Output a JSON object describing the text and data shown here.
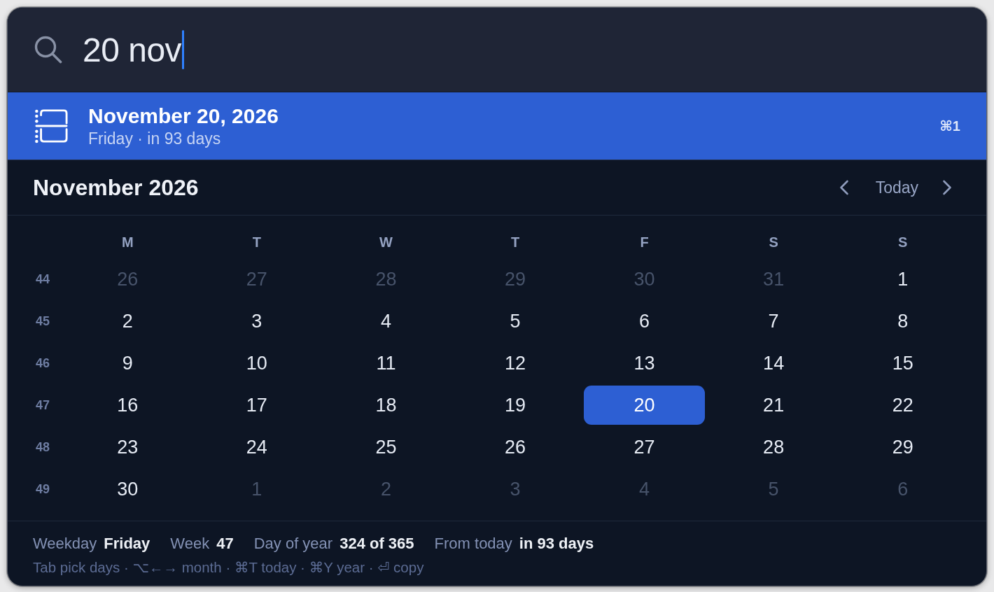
{
  "search": {
    "value": "20 nov"
  },
  "results": [
    {
      "title": "November 20, 2026",
      "subtitle": "Friday · in 93 days",
      "shortcut": "⌘1",
      "selected": true
    }
  ],
  "calendar": {
    "title": "November 2026",
    "today_button": "Today",
    "weekdays": [
      "M",
      "T",
      "W",
      "T",
      "F",
      "S",
      "S"
    ],
    "weeks": [
      {
        "number": "44",
        "days": [
          {
            "label": "26",
            "in_month": false,
            "selected": false
          },
          {
            "label": "27",
            "in_month": false,
            "selected": false
          },
          {
            "label": "28",
            "in_month": false,
            "selected": false
          },
          {
            "label": "29",
            "in_month": false,
            "selected": false
          },
          {
            "label": "30",
            "in_month": false,
            "selected": false
          },
          {
            "label": "31",
            "in_month": false,
            "selected": false
          },
          {
            "label": "1",
            "in_month": true,
            "selected": false
          }
        ]
      },
      {
        "number": "45",
        "days": [
          {
            "label": "2",
            "in_month": true,
            "selected": false
          },
          {
            "label": "3",
            "in_month": true,
            "selected": false
          },
          {
            "label": "4",
            "in_month": true,
            "selected": false
          },
          {
            "label": "5",
            "in_month": true,
            "selected": false
          },
          {
            "label": "6",
            "in_month": true,
            "selected": false
          },
          {
            "label": "7",
            "in_month": true,
            "selected": false
          },
          {
            "label": "8",
            "in_month": true,
            "selected": false
          }
        ]
      },
      {
        "number": "46",
        "days": [
          {
            "label": "9",
            "in_month": true,
            "selected": false
          },
          {
            "label": "10",
            "in_month": true,
            "selected": false
          },
          {
            "label": "11",
            "in_month": true,
            "selected": false
          },
          {
            "label": "12",
            "in_month": true,
            "selected": false
          },
          {
            "label": "13",
            "in_month": true,
            "selected": false
          },
          {
            "label": "14",
            "in_month": true,
            "selected": false
          },
          {
            "label": "15",
            "in_month": true,
            "selected": false
          }
        ]
      },
      {
        "number": "47",
        "days": [
          {
            "label": "16",
            "in_month": true,
            "selected": false
          },
          {
            "label": "17",
            "in_month": true,
            "selected": false
          },
          {
            "label": "18",
            "in_month": true,
            "selected": false
          },
          {
            "label": "19",
            "in_month": true,
            "selected": false
          },
          {
            "label": "20",
            "in_month": true,
            "selected": true
          },
          {
            "label": "21",
            "in_month": true,
            "selected": false
          },
          {
            "label": "22",
            "in_month": true,
            "selected": false
          }
        ]
      },
      {
        "number": "48",
        "days": [
          {
            "label": "23",
            "in_month": true,
            "selected": false
          },
          {
            "label": "24",
            "in_month": true,
            "selected": false
          },
          {
            "label": "25",
            "in_month": true,
            "selected": false
          },
          {
            "label": "26",
            "in_month": true,
            "selected": false
          },
          {
            "label": "27",
            "in_month": true,
            "selected": false
          },
          {
            "label": "28",
            "in_month": true,
            "selected": false
          },
          {
            "label": "29",
            "in_month": true,
            "selected": false
          }
        ]
      },
      {
        "number": "49",
        "days": [
          {
            "label": "30",
            "in_month": true,
            "selected": false
          },
          {
            "label": "1",
            "in_month": false,
            "selected": false
          },
          {
            "label": "2",
            "in_month": false,
            "selected": false
          },
          {
            "label": "3",
            "in_month": false,
            "selected": false
          },
          {
            "label": "4",
            "in_month": false,
            "selected": false
          },
          {
            "label": "5",
            "in_month": false,
            "selected": false
          },
          {
            "label": "6",
            "in_month": false,
            "selected": false
          }
        ]
      }
    ]
  },
  "details": [
    {
      "label": "Weekday",
      "value": "Friday"
    },
    {
      "label": "Week",
      "value": "47"
    },
    {
      "label": "Day of year",
      "value": "324 of 365"
    },
    {
      "label": "From today",
      "value": "in 93 days"
    }
  ],
  "hints": "Tab pick days · ⌥←→ month · ⌘T today · ⌘Y year · ⏎ copy"
}
